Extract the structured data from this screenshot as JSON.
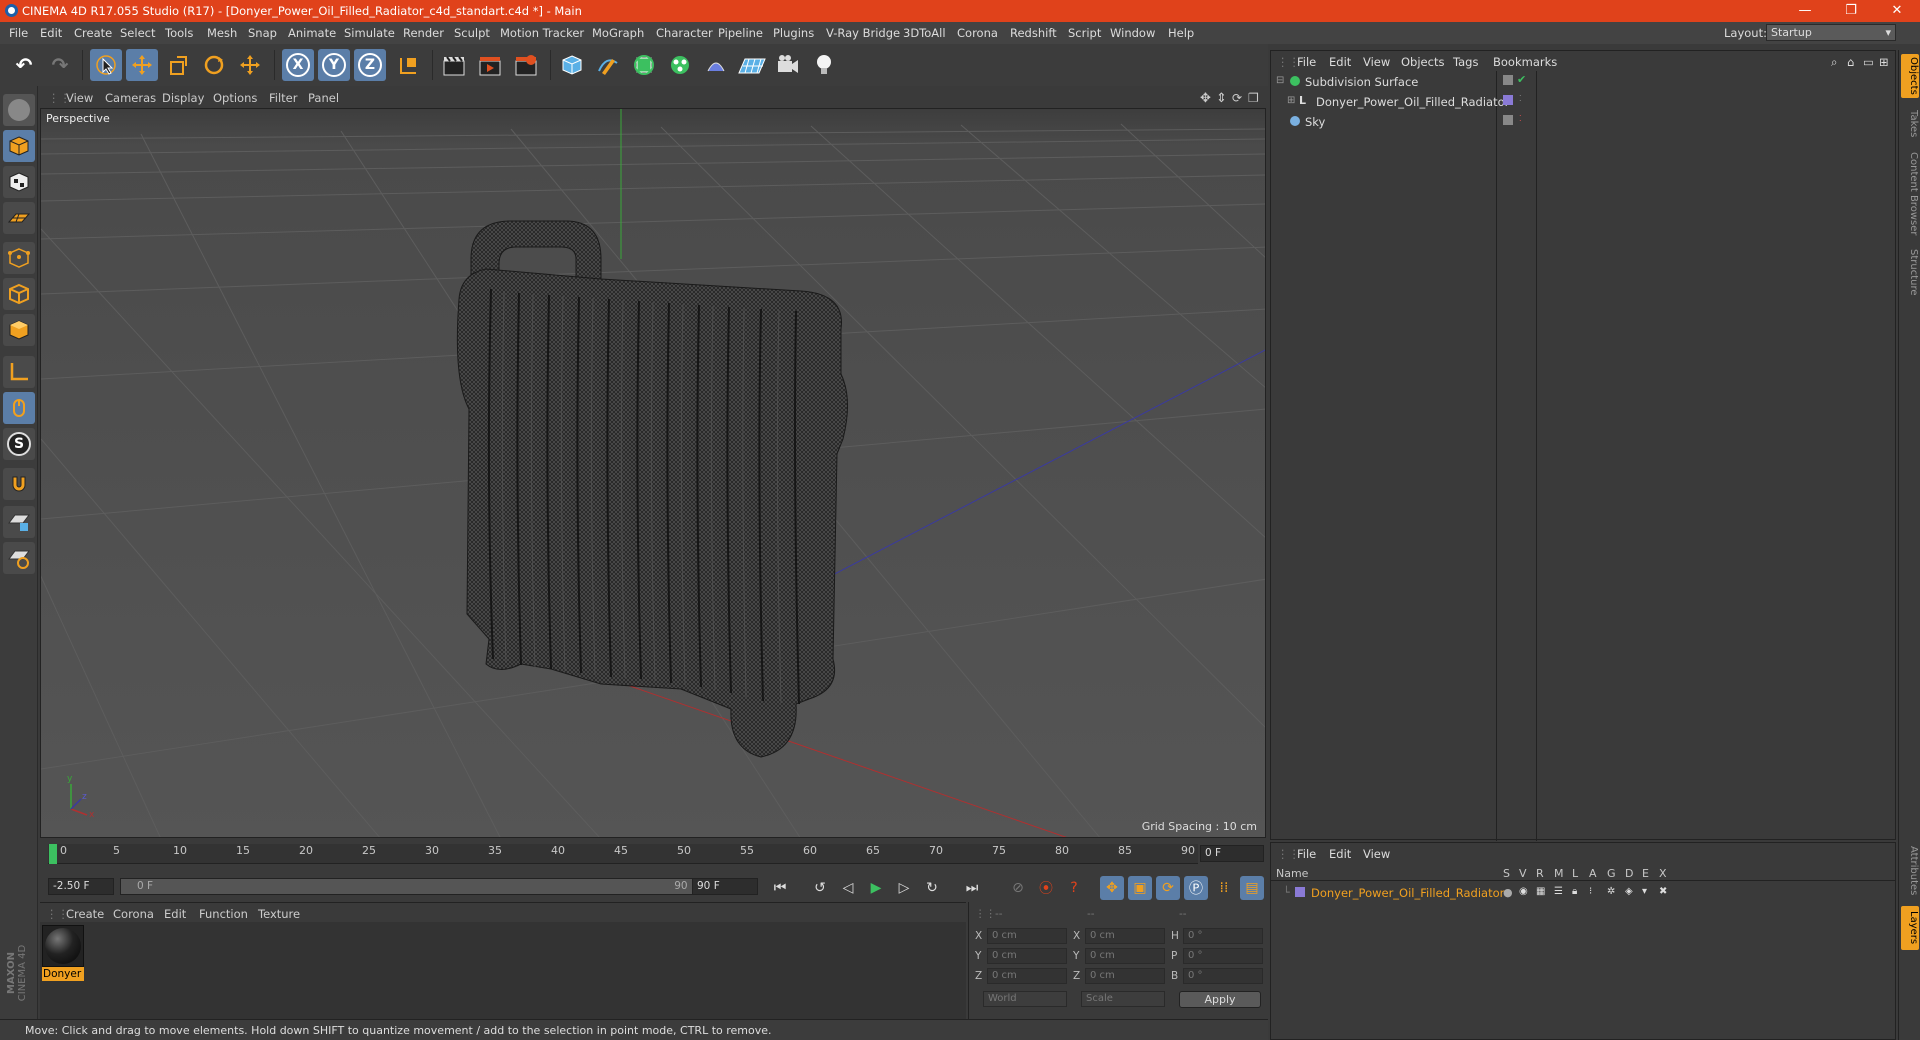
{
  "titlebar": {
    "title": "CINEMA 4D R17.055 Studio (R17) - [Donyer_Power_Oil_Filled_Radiator_c4d_standart.c4d *] - Main",
    "minimize": "—",
    "restore": "❐",
    "close": "✕"
  },
  "menubar": {
    "items": [
      "File",
      "Edit",
      "Create",
      "Select",
      "Tools",
      "Mesh",
      "Snap",
      "Animate",
      "Simulate",
      "Render",
      "Sculpt",
      "Motion Tracker",
      "MoGraph",
      "Character",
      "Pipeline",
      "Plugins",
      "V-Ray Bridge",
      "3DToAll",
      "Corona",
      "Redshift",
      "Script",
      "Window",
      "Help"
    ],
    "layout_label": "Layout:",
    "layout_value": "Startup"
  },
  "viewport": {
    "menu": [
      "View",
      "Cameras",
      "Display",
      "Options",
      "Filter",
      "Panel"
    ],
    "label": "Perspective",
    "grid_spacing": "Grid Spacing : 10 cm"
  },
  "timeline": {
    "ticks": [
      "0",
      "5",
      "10",
      "15",
      "20",
      "25",
      "30",
      "35",
      "40",
      "45",
      "50",
      "55",
      "60",
      "65",
      "70",
      "75",
      "80",
      "85",
      "90"
    ],
    "current_frame": "0 F",
    "start_field": "-2.50 F",
    "range_start": "0 F",
    "range_end": "90 F",
    "end_field": "90 F"
  },
  "material_manager": {
    "menu": [
      "Create",
      "Corona",
      "Edit",
      "Function",
      "Texture"
    ],
    "material_name": "Donyer"
  },
  "coordinates": {
    "headers": [
      "--",
      "--",
      "--"
    ],
    "rows": [
      {
        "l1": "X",
        "v1": "0 cm",
        "l2": "X",
        "v2": "0 cm",
        "l3": "H",
        "v3": "0 °"
      },
      {
        "l1": "Y",
        "v1": "0 cm",
        "l2": "Y",
        "v2": "0 cm",
        "l3": "P",
        "v3": "0 °"
      },
      {
        "l1": "Z",
        "v1": "0 cm",
        "l2": "Z",
        "v2": "0 cm",
        "l3": "B",
        "v3": "0 °"
      }
    ],
    "world": "World",
    "scale": "Scale",
    "apply": "Apply"
  },
  "status": {
    "text": "Move: Click and drag to move elements. Hold down SHIFT to quantize movement / add to the selection in point mode, CTRL to remove."
  },
  "object_manager": {
    "menu": [
      "File",
      "Edit",
      "View",
      "Objects",
      "Tags",
      "Bookmarks"
    ],
    "objects": [
      {
        "name": "Subdivision Surface"
      },
      {
        "name": "Donyer_Power_Oil_Filled_Radiator"
      },
      {
        "name": "Sky"
      }
    ]
  },
  "layer_manager": {
    "menu": [
      "File",
      "Edit",
      "View"
    ],
    "columns": [
      "Name",
      "S",
      "V",
      "R",
      "M",
      "L",
      "A",
      "G",
      "D",
      "E",
      "X"
    ],
    "layer_name": "Donyer_Power_Oil_Filled_Radiator"
  },
  "right_tabs": [
    "Objects",
    "Takes",
    "Content Browser",
    "Structure",
    "Attributes",
    "Layers"
  ],
  "logo": {
    "line1": "MAXON",
    "line2": "CINEMA 4D"
  },
  "colors": {
    "titlebar": "#e0421b",
    "accent": "#f0a020",
    "selected": "#5b7ea8"
  }
}
